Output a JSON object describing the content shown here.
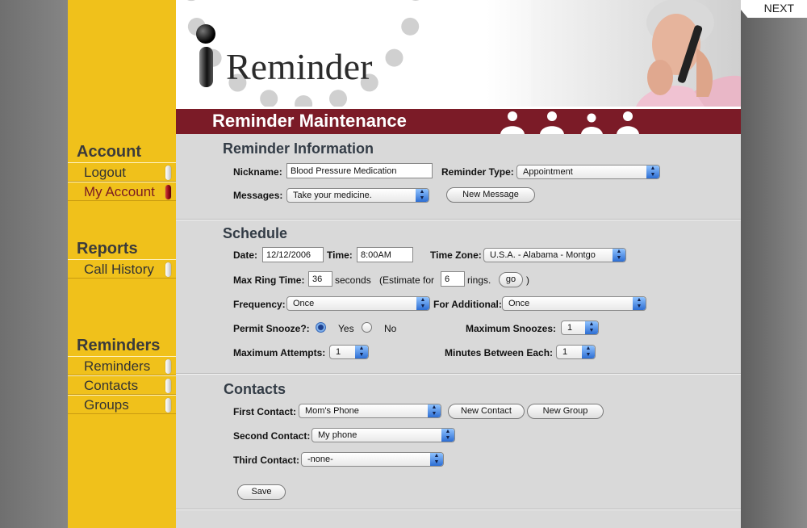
{
  "next_label": "NEXT",
  "logo": {
    "text": "Reminder"
  },
  "sidebar": {
    "sections": [
      {
        "heading": "Account",
        "items": [
          {
            "label": "Logout",
            "active": false
          },
          {
            "label": "My Account",
            "active": true
          }
        ]
      },
      {
        "heading": "Reports",
        "items": [
          {
            "label": "Call History",
            "active": false
          }
        ]
      },
      {
        "heading": "Reminders",
        "items": [
          {
            "label": "Reminders",
            "active": false
          },
          {
            "label": "Contacts",
            "active": false
          },
          {
            "label": "Groups",
            "active": false
          }
        ]
      }
    ]
  },
  "page_title": "Reminder Maintenance",
  "reminder_info": {
    "title": "Reminder Information",
    "nickname_label": "Nickname:",
    "nickname_value": "Blood Pressure Medication",
    "type_label": "Reminder Type:",
    "type_value": "Appointment",
    "messages_label": "Messages:",
    "messages_value": "Take your medicine.",
    "new_message_button": "New Message"
  },
  "schedule": {
    "title": "Schedule",
    "date_label": "Date:",
    "date_value": "12/12/2006",
    "time_label": "Time:",
    "time_value": "8:00AM",
    "timezone_label": "Time Zone:",
    "timezone_value": "U.S.A. - Alabama - Montgo",
    "max_ring_label": "Max Ring Time:",
    "max_ring_value": "36",
    "seconds_text": "seconds",
    "estimate_text": "(Estimate for",
    "rings_value": "6",
    "rings_text": "rings.",
    "go_button": "go",
    "close_paren": ")",
    "frequency_label": "Frequency:",
    "frequency_value": "Once",
    "additional_label": "For Additional:",
    "additional_value": "Once",
    "snooze_label": "Permit Snooze?:",
    "snooze_yes": "Yes",
    "snooze_no": "No",
    "snooze_selected": "Yes",
    "max_snoozes_label": "Maximum Snoozes:",
    "max_snoozes_value": "1",
    "max_attempts_label": "Maximum Attempts:",
    "max_attempts_value": "1",
    "minutes_between_label": "Minutes Between Each:",
    "minutes_between_value": "1"
  },
  "contacts": {
    "title": "Contacts",
    "first_label": "First Contact:",
    "first_value": "Mom's Phone",
    "new_contact_button": "New Contact",
    "new_group_button": "New Group",
    "second_label": "Second Contact:",
    "second_value": "My phone",
    "third_label": "Third Contact:",
    "third_value": "-none-",
    "save_button": "Save"
  },
  "colors": {
    "sidebar": "#f0c11b",
    "title_bar": "#7b1b27",
    "content_bg": "#d9d9d9",
    "select_arrow": "#3b7ee0"
  }
}
